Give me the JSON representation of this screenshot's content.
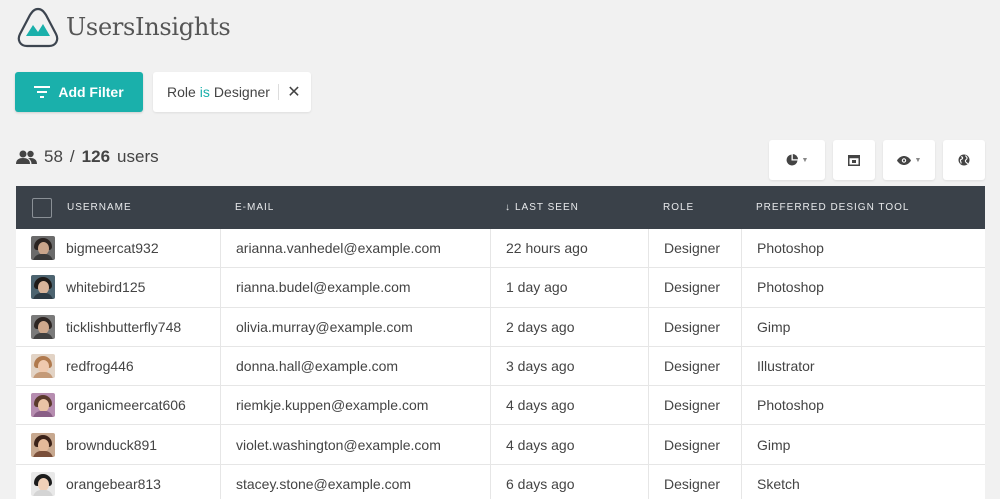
{
  "app": {
    "logo_text": "UsersInsights",
    "colors": {
      "accent": "#1ab0ab",
      "header": "#3a4149",
      "background": "#f1f1f1"
    }
  },
  "filters": {
    "add_filter_label": "Add Filter",
    "active": [
      {
        "field": "Role",
        "operator": "is",
        "value": "Designer"
      }
    ]
  },
  "counts": {
    "filtered": "58",
    "separator": "/",
    "total": "126",
    "unit": "users"
  },
  "toolbar": {
    "buttons": [
      {
        "icon": "pie-chart-icon",
        "has_dropdown": true
      },
      {
        "icon": "columns-icon",
        "has_dropdown": false
      },
      {
        "icon": "eye-icon",
        "has_dropdown": true
      },
      {
        "icon": "globe-icon",
        "has_dropdown": false
      }
    ]
  },
  "table": {
    "columns": {
      "username": "Username",
      "email": "E-mail",
      "last_seen": "Last Seen",
      "role": "Role",
      "tool": "Preferred Design Tool"
    },
    "sort": {
      "column": "last_seen",
      "direction": "desc",
      "icon": "sort-down-arrow-icon"
    },
    "rows": [
      {
        "username": "bigmeercat932",
        "email": "arianna.vanhedel@example.com",
        "last_seen": "22 hours ago",
        "role": "Designer",
        "tool": "Photoshop"
      },
      {
        "username": "whitebird125",
        "email": "rianna.budel@example.com",
        "last_seen": "1 day ago",
        "role": "Designer",
        "tool": "Photoshop"
      },
      {
        "username": "ticklishbutterfly748",
        "email": "olivia.murray@example.com",
        "last_seen": "2 days ago",
        "role": "Designer",
        "tool": "Gimp"
      },
      {
        "username": "redfrog446",
        "email": "donna.hall@example.com",
        "last_seen": "3 days ago",
        "role": "Designer",
        "tool": "Illustrator"
      },
      {
        "username": "organicmeercat606",
        "email": "riemkje.kuppen@example.com",
        "last_seen": "4 days ago",
        "role": "Designer",
        "tool": "Photoshop"
      },
      {
        "username": "brownduck891",
        "email": "violet.washington@example.com",
        "last_seen": "4 days ago",
        "role": "Designer",
        "tool": "Gimp"
      },
      {
        "username": "orangebear813",
        "email": "stacey.stone@example.com",
        "last_seen": "6 days ago",
        "role": "Designer",
        "tool": "Sketch"
      }
    ]
  }
}
